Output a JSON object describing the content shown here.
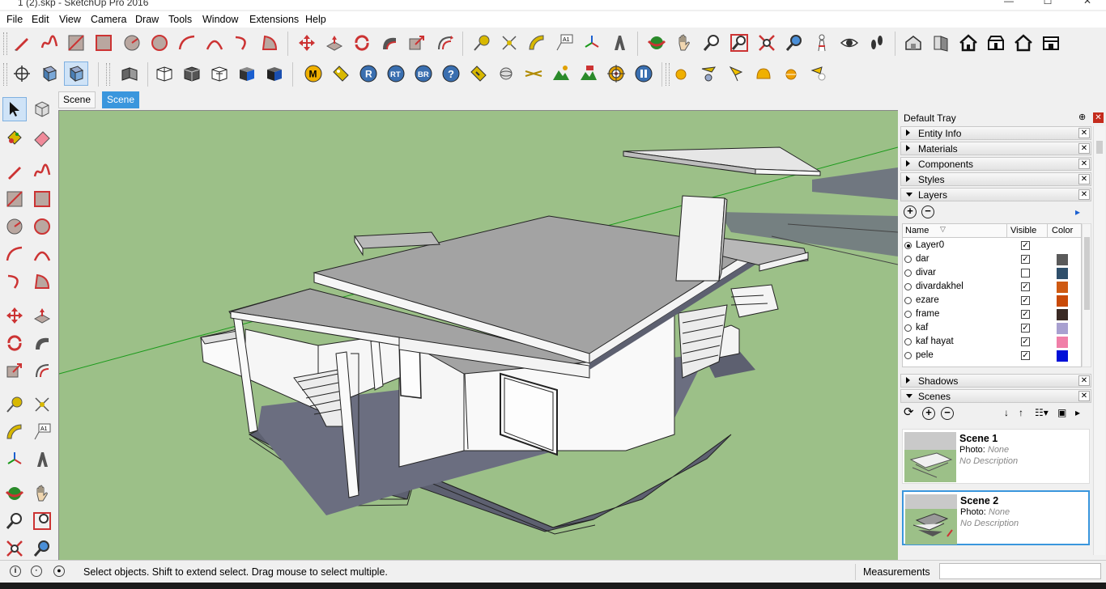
{
  "window": {
    "title": "1 (2).skp - SketchUp Pro 2016",
    "minimize": "—",
    "maximize": "☐",
    "close": "✕"
  },
  "menu": [
    "File",
    "Edit",
    "View",
    "Camera",
    "Draw",
    "Tools",
    "Window",
    "Extensions",
    "Help"
  ],
  "toolbar1": [
    "pencil",
    "freehand",
    "rectangle",
    "rotated-rectangle",
    "circle",
    "polygon",
    "arc",
    "2pt-arc",
    "3pt-arc",
    "pie",
    "move",
    "push-pull",
    "rotate",
    "follow-me",
    "scale",
    "offset",
    "tape-measure",
    "dimension",
    "protractor",
    "text",
    "axes",
    "3d-text",
    "orbit",
    "pan",
    "zoom",
    "zoom-window",
    "zoom-extents",
    "previous",
    "position-camera",
    "look-around",
    "walk",
    "warehouse",
    "extension-warehouse",
    "component-warehouse",
    "share-model",
    "upload",
    "layout"
  ],
  "toolbar2": [
    "section-plane",
    "display-section",
    "display-cuts",
    "x-ray",
    "back-edges",
    "wireframe",
    "hidden-line",
    "shaded",
    "shaded-textures",
    "monochrome"
  ],
  "toolbar2_labels": {
    "m": "M",
    "r": "R",
    "rt": "RT",
    "br": "BR",
    "help": "?"
  },
  "tabs": [
    {
      "label": "Scene 1",
      "active": false
    },
    {
      "label": "Scene 2",
      "active": true
    }
  ],
  "tray": {
    "title": "Default Tray",
    "pin": "⊕",
    "panels": [
      "Entity Info",
      "Materials",
      "Components",
      "Styles",
      "Layers"
    ],
    "layers": {
      "columns": {
        "name": "Name",
        "visible": "Visible",
        "color": "Color"
      },
      "rows": [
        {
          "name": "Layer0",
          "visible": true,
          "selected": true,
          "color": ""
        },
        {
          "name": "dar",
          "visible": true,
          "color": "#5a5a5a"
        },
        {
          "name": "divar",
          "visible": false,
          "color": "#2f4f6b"
        },
        {
          "name": "divardakhel",
          "visible": true,
          "color": "#cf5a12"
        },
        {
          "name": "ezare",
          "visible": true,
          "color": "#c94a08"
        },
        {
          "name": "frame",
          "visible": true,
          "color": "#3a2a24"
        },
        {
          "name": "kaf",
          "visible": true,
          "color": "#a8a0d0"
        },
        {
          "name": "kaf hayat",
          "visible": true,
          "color": "#f07fa8"
        },
        {
          "name": "pele",
          "visible": true,
          "color": "#0010d8"
        }
      ]
    },
    "panels_bottom": [
      "Shadows",
      "Scenes"
    ],
    "scenes": [
      {
        "name": "Scene 1",
        "photo_label": "Photo:",
        "photo": "None",
        "description": "No Description",
        "selected": false
      },
      {
        "name": "Scene 2",
        "photo_label": "Photo:",
        "photo": "None",
        "description": "No Description",
        "selected": true
      }
    ]
  },
  "status": {
    "message": "Select objects. Shift to extend select. Drag mouse to select multiple.",
    "measurements_label": "Measurements",
    "measurements_value": ""
  },
  "colors": {
    "viewport_bg": "#9cc088",
    "accent": "#3a96dd"
  }
}
